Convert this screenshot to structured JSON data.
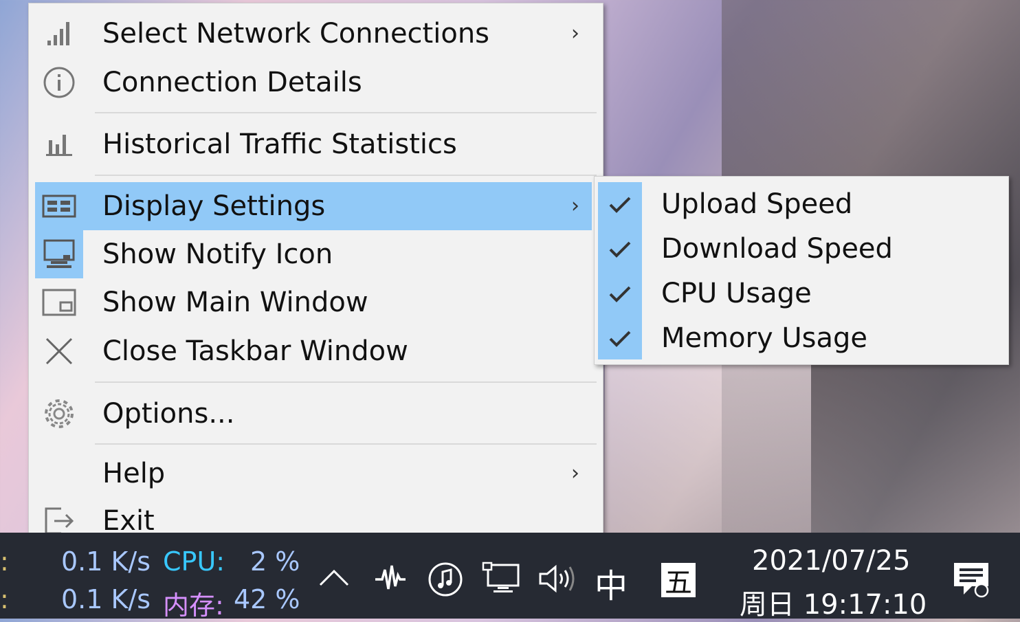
{
  "menu": {
    "items": [
      {
        "label": "Select Network Connections",
        "icon": "signal-bars-icon",
        "submenu": true
      },
      {
        "label": "Connection Details",
        "icon": "info-icon",
        "submenu": false
      },
      {
        "label": "Historical Traffic Statistics",
        "icon": "bar-chart-icon",
        "submenu": false
      },
      {
        "label": "Display Settings",
        "icon": "display-settings-icon",
        "submenu": true,
        "highlighted": true
      },
      {
        "label": "Show Notify Icon",
        "icon": "notify-icon",
        "submenu": false,
        "checked": true
      },
      {
        "label": "Show Main Window",
        "icon": "main-window-icon",
        "submenu": false
      },
      {
        "label": "Close Taskbar Window",
        "icon": "close-icon",
        "submenu": false
      },
      {
        "label": "Options...",
        "icon": "gear-icon",
        "submenu": false
      },
      {
        "label": "Help",
        "icon": "",
        "submenu": true
      },
      {
        "label": "Exit",
        "icon": "exit-icon",
        "submenu": false
      }
    ],
    "arrow_glyph": "›"
  },
  "submenu": {
    "items": [
      {
        "label": "Upload Speed",
        "checked": true
      },
      {
        "label": "Download Speed",
        "checked": true
      },
      {
        "label": "CPU Usage",
        "checked": true
      },
      {
        "label": "Memory Usage",
        "checked": true
      }
    ]
  },
  "taskbar": {
    "monitor": {
      "row1_prefix": ":",
      "row2_prefix": ":",
      "upload_value": "0.1 K/s",
      "download_value": "0.1 K/s",
      "cpu_label": "CPU:",
      "cpu_value": "2 %",
      "mem_label": "内存:",
      "mem_value": "42 %",
      "colors": {
        "value": "#a9c8ff",
        "cpu_label": "#38c8ff",
        "mem_label": "#d690ff"
      }
    },
    "tray_icons": [
      "chevron-up-icon",
      "waveform-icon",
      "music-icon",
      "network-monitor-icon",
      "volume-icon"
    ],
    "ime_mode": "中",
    "ime_input": "五",
    "date": "2021/07/25",
    "time": "周日 19:17:10",
    "notification_icon": "notification-icon"
  },
  "colors": {
    "highlight": "#91c9f7",
    "menu_bg": "#f2f2f2",
    "taskbar_bg": "#262a33"
  }
}
